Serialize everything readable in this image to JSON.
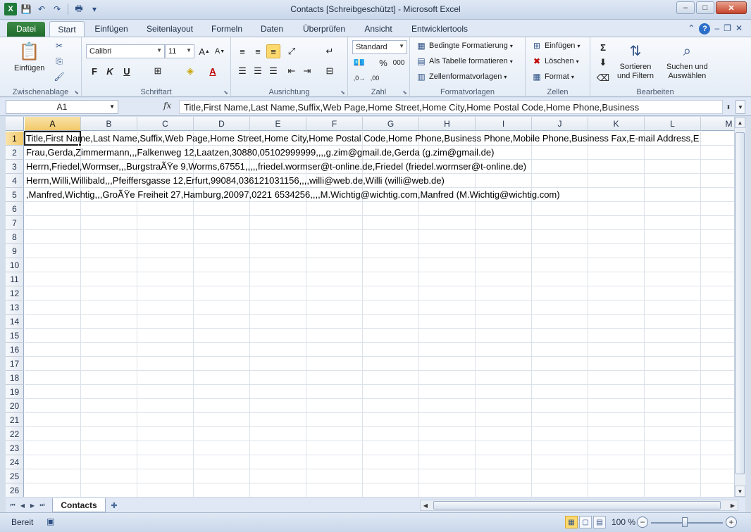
{
  "window": {
    "title": "Contacts  [Schreibgeschützt]  -  Microsoft Excel",
    "app_icon_letter": "X",
    "controls": {
      "minimize": "–",
      "maximize": "□",
      "close": "✕"
    }
  },
  "qat": {
    "save": "💾",
    "undo": "↶",
    "redo": "↷",
    "print": "🖶",
    "customize": "▾"
  },
  "ribbon_tabs": {
    "file": "Datei",
    "items": [
      "Start",
      "Einfügen",
      "Seitenlayout",
      "Formeln",
      "Daten",
      "Überprüfen",
      "Ansicht",
      "Entwicklertools"
    ]
  },
  "ribbon": {
    "clipboard": {
      "label": "Zwischenablage",
      "paste": "Einfügen"
    },
    "font": {
      "label": "Schriftart",
      "name": "Calibri",
      "size": "11",
      "bold": "F",
      "italic": "K",
      "underline": "U"
    },
    "alignment": {
      "label": "Ausrichtung"
    },
    "number": {
      "label": "Zahl",
      "format": "Standard",
      "percent": "%",
      "thousands": "000"
    },
    "styles": {
      "label": "Formatvorlagen",
      "conditional": "Bedingte Formatierung",
      "as_table": "Als Tabelle formatieren",
      "cell_styles": "Zellenformatvorlagen"
    },
    "cells": {
      "label": "Zellen",
      "insert": "Einfügen",
      "delete": "Löschen",
      "format": "Format"
    },
    "editing": {
      "label": "Bearbeiten",
      "sort_filter_1": "Sortieren",
      "sort_filter_2": "und Filtern",
      "find_1": "Suchen und",
      "find_2": "Auswählen",
      "sum": "Σ"
    }
  },
  "formula_bar": {
    "name_box": "A1",
    "fx": "fx",
    "content": "Title,First Name,Last Name,Suffix,Web Page,Home Street,Home City,Home Postal Code,Home Phone,Business"
  },
  "sheet": {
    "columns": [
      "A",
      "B",
      "C",
      "D",
      "E",
      "F",
      "G",
      "H",
      "I",
      "J",
      "K",
      "L",
      "M"
    ],
    "rows": [
      "1",
      "2",
      "3",
      "4",
      "5",
      "6",
      "7",
      "8",
      "9",
      "10",
      "11",
      "12",
      "13",
      "14",
      "15",
      "16",
      "17",
      "18",
      "19",
      "20",
      "21",
      "22",
      "23",
      "24",
      "25",
      "26"
    ],
    "cells": [
      "Title,First Name,Last Name,Suffix,Web Page,Home Street,Home City,Home Postal Code,Home Phone,Business Phone,Mobile Phone,Business Fax,E-mail Address,E",
      "Frau,Gerda,Zimmermann,,,Falkenweg 12,Laatzen,30880,05102999999,,,,g.zim@gmail.de,Gerda (g.zim@gmail.de)",
      "Herrn,Friedel,Wormser,,,BurgstraÃŸe 9,Worms,67551,,,,,friedel.wormser@t-online.de,Friedel (friedel.wormser@t-online.de)",
      "Herrn,Willi,Willibald,,,Pfeiffersgasse 12,Erfurt,99084,036121031156,,,,willi@web.de,Willi (willi@web.de)",
      ",Manfred,Wichtig,,,GroÃŸe Freiheit 27,Hamburg,20097,0221 6534256,,,,M.Wichtig@wichtig.com,Manfred (M.Wichtig@wichtig.com)"
    ],
    "tab_name": "Contacts"
  },
  "status": {
    "ready": "Bereit",
    "zoom": "100 %",
    "zoom_minus": "−",
    "zoom_plus": "+"
  }
}
